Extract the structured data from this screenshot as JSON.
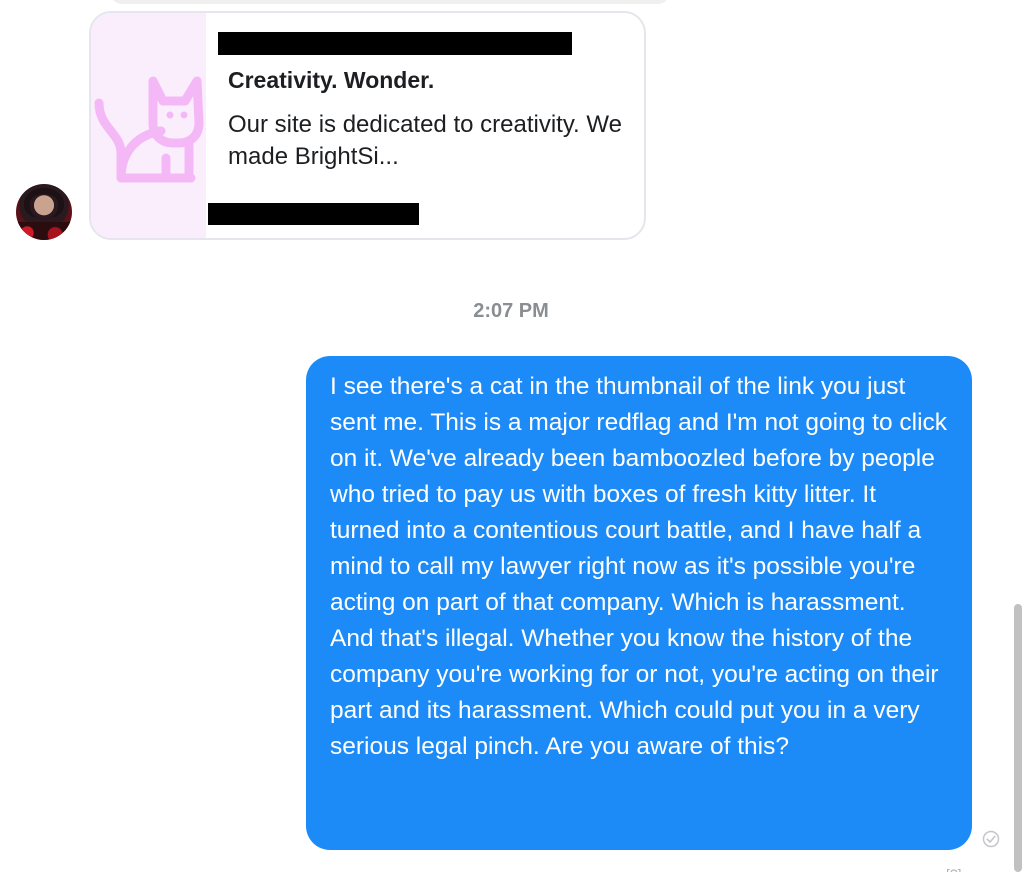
{
  "link_preview": {
    "title": "Creativity. Wonder.",
    "description": "Our site is dedicated to creativity. We made BrightSi...",
    "thumbnail_icon": "cat-icon",
    "thumbnail_color": "#f4b8f7"
  },
  "conversation": {
    "timestamp": "2:07 PM",
    "sent_message": "I see there's a cat in the thumbnail of the link you just sent me. This is a major redflag and I'm not going to click on it. We've already been bamboozled before by people who tried to pay us with boxes of fresh kitty litter. It turned into a contentious court battle, and I have half a mind to call my lawyer right now as it's possible you're acting on part of that company. Which is harassment. And that's illegal. Whether you know the history of the company you're working for or not, you're acting on their part and its harassment. Which could put you in a very serious legal pinch. Are you aware of this?",
    "sent_bubble_color": "#1d8bf7",
    "status_icon": "seen-check-icon",
    "cut_off_label": "[?]"
  }
}
